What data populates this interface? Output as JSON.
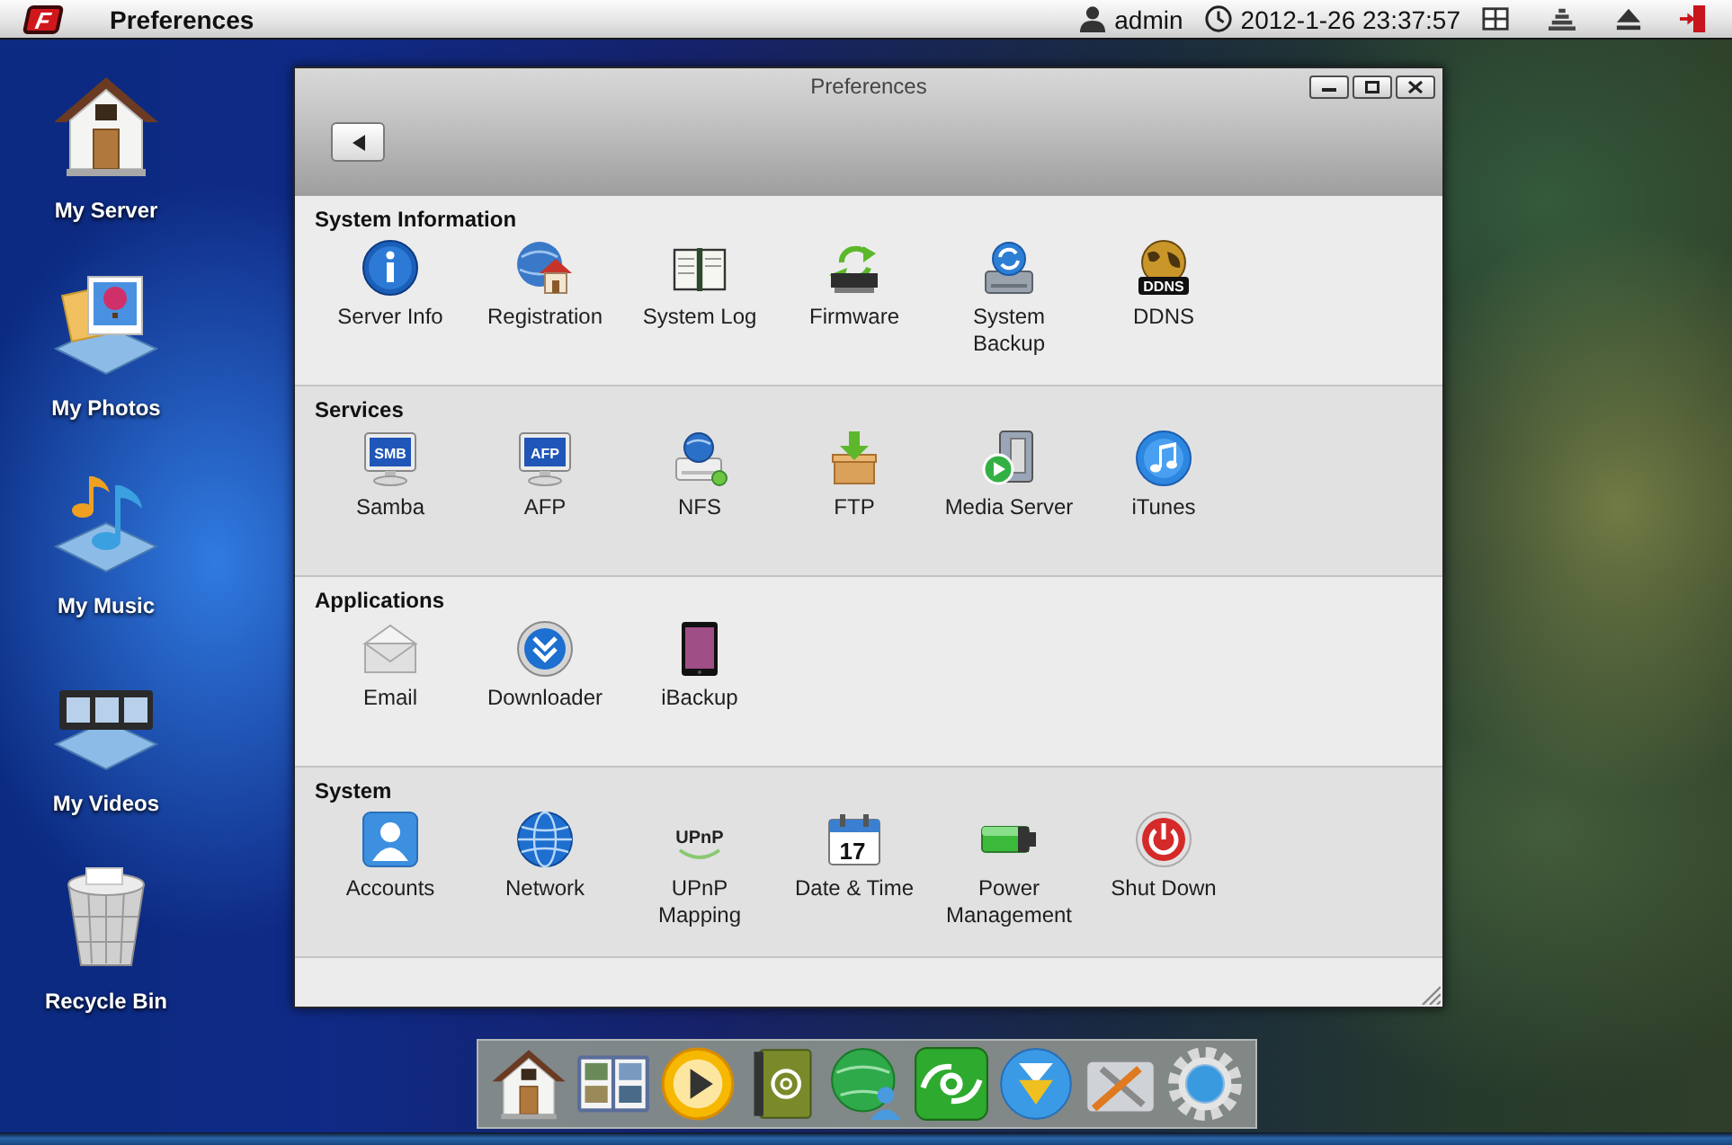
{
  "top_bar": {
    "logo": "F",
    "title": "Preferences",
    "user": "admin",
    "datetime": "2012-1-26 23:37:57"
  },
  "desktop_shortcuts": [
    {
      "label": "My Server"
    },
    {
      "label": "My Photos"
    },
    {
      "label": "My Music"
    },
    {
      "label": "My Videos"
    },
    {
      "label": "Recycle Bin"
    }
  ],
  "window": {
    "title": "Preferences",
    "sections": [
      {
        "title": "System Information",
        "items": [
          {
            "label": "Server Info"
          },
          {
            "label": "Registration"
          },
          {
            "label": "System Log"
          },
          {
            "label": "Firmware"
          },
          {
            "label": "System Backup"
          },
          {
            "label": "DDNS",
            "icon_text": "DDNS"
          }
        ]
      },
      {
        "title": "Services",
        "items": [
          {
            "label": "Samba",
            "icon_text": "SMB"
          },
          {
            "label": "AFP",
            "icon_text": "AFP"
          },
          {
            "label": "NFS"
          },
          {
            "label": "FTP"
          },
          {
            "label": "Media Server"
          },
          {
            "label": "iTunes"
          }
        ]
      },
      {
        "title": "Applications",
        "items": [
          {
            "label": "Email"
          },
          {
            "label": "Downloader"
          },
          {
            "label": "iBackup"
          }
        ]
      },
      {
        "title": "System",
        "items": [
          {
            "label": "Accounts"
          },
          {
            "label": "Network"
          },
          {
            "label": "UPnP Mapping",
            "icon_text": "UPnP"
          },
          {
            "label": "Date & Time",
            "icon_text": "17"
          },
          {
            "label": "Power Management"
          },
          {
            "label": "Shut Down"
          }
        ]
      }
    ]
  }
}
